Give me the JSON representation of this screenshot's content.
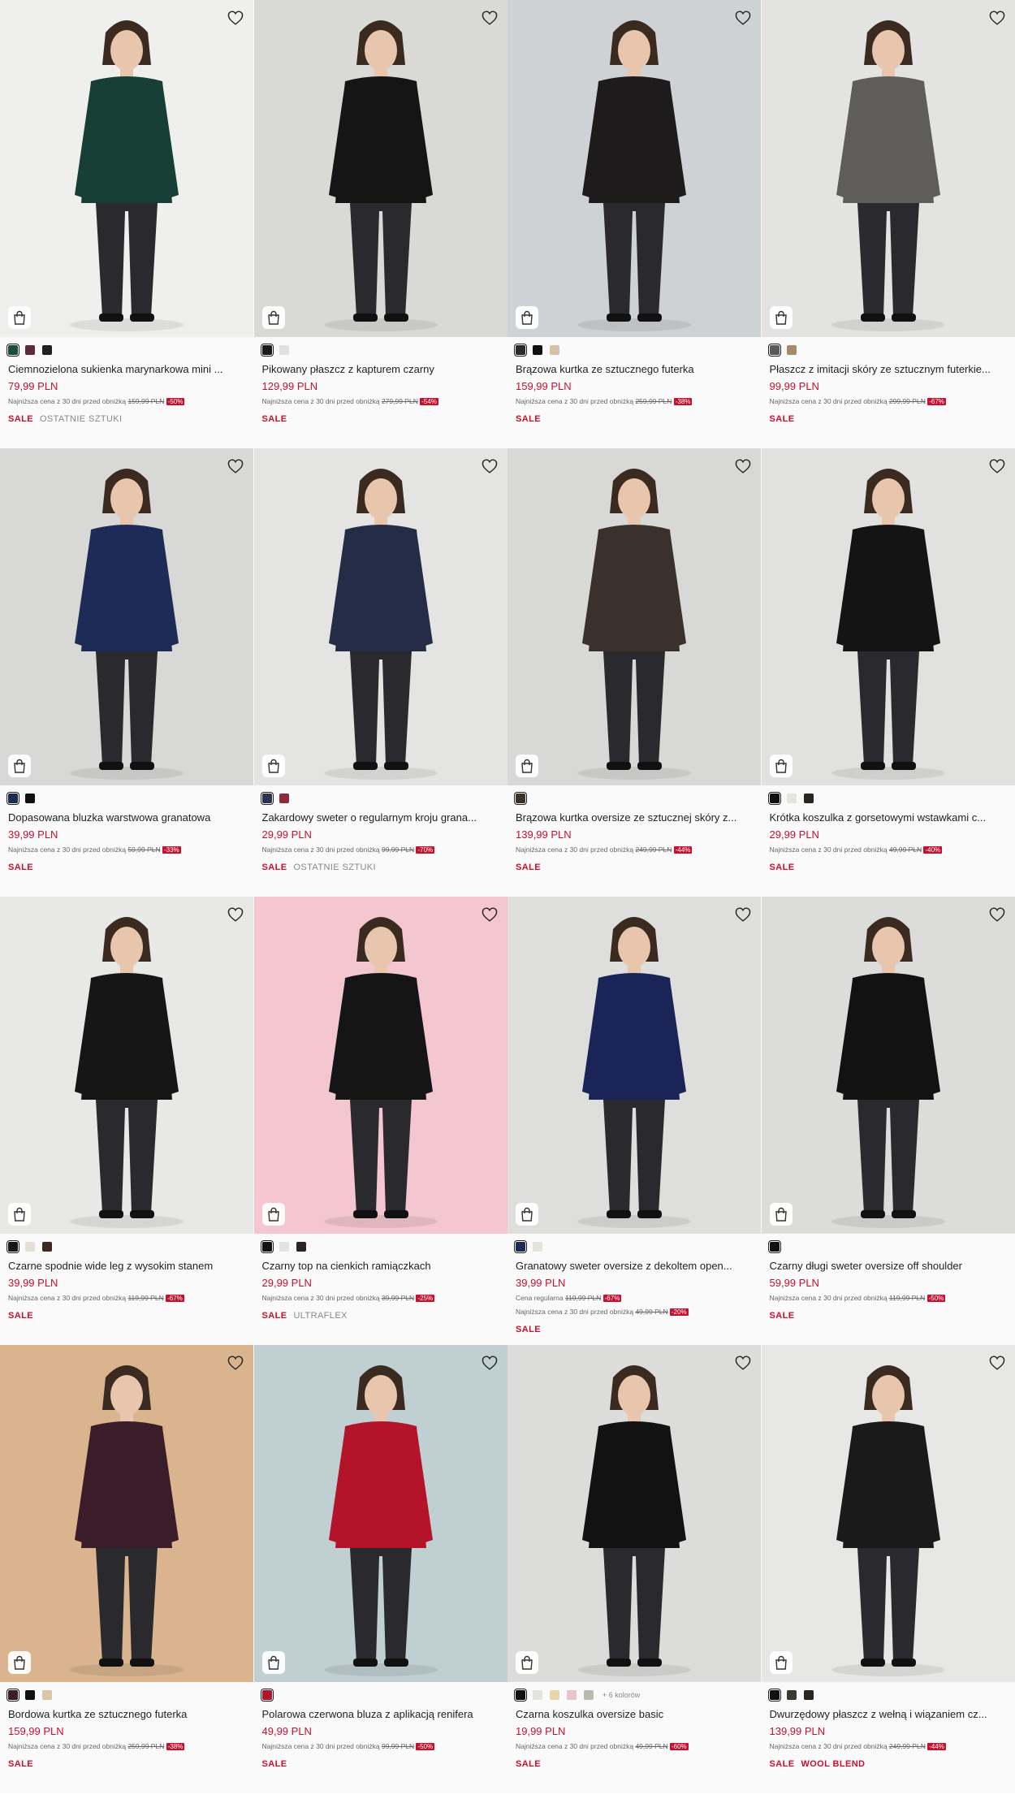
{
  "products": [
    {
      "name": "Ciemnozielona sukienka marynarkowa mini ...",
      "price": "79,99 PLN",
      "lowest_label": "Najniższa cena z 30 dni przed obniżką",
      "old_price": "159,99 PLN",
      "discount": "-50%",
      "tags": [
        "SALE",
        "OSTATNIE SZTUKI"
      ],
      "swatches": [
        "#1c4b3f",
        "#5a2b39",
        "#222222"
      ],
      "bg": "#efefed",
      "outfit": "#173f35"
    },
    {
      "name": "Pikowany płaszcz z kapturem czarny",
      "price": "129,99 PLN",
      "lowest_label": "Najniższa cena z 30 dni przed obniżką",
      "old_price": "279,99 PLN",
      "discount": "-54%",
      "tags": [
        "SALE"
      ],
      "swatches": [
        "#1a1a1a",
        "#e2e0da"
      ],
      "bg": "#d9d9d6",
      "outfit": "#151515"
    },
    {
      "name": "Brązowa kurtka ze sztucznego futerka",
      "price": "159,99 PLN",
      "lowest_label": "Najniższa cena z 30 dni przed obniżką",
      "old_price": "259,99 PLN",
      "discount": "-38%",
      "tags": [
        "SALE"
      ],
      "swatches": [
        "#2a2a2a",
        "#111111",
        "#d7c2a6"
      ],
      "bg": "#cfd2d4",
      "outfit": "#1d1b1b"
    },
    {
      "name": "Płaszcz z imitacji skóry ze sztucznym futerkie...",
      "price": "99,99 PLN",
      "lowest_label": "Najniższa cena z 30 dni przed obniżką",
      "old_price": "299,99 PLN",
      "discount": "-67%",
      "tags": [
        "SALE"
      ],
      "swatches": [
        "#5a5a58",
        "#a68a6a"
      ],
      "bg": "#e3e3e1",
      "outfit": "#5f5d5a"
    },
    {
      "name": "Dopasowana bluzka warstwowa granatowa",
      "price": "39,99 PLN",
      "lowest_label": "Najniższa cena z 30 dni przed obniżką",
      "old_price": "59,99 PLN",
      "discount": "-33%",
      "tags": [
        "SALE"
      ],
      "swatches": [
        "#1d2a52",
        "#111111"
      ],
      "bg": "#d8d8d6",
      "outfit": "#1f2b57"
    },
    {
      "name": "Zakardowy sweter o regularnym kroju grana...",
      "price": "29,99 PLN",
      "lowest_label": "Najniższa cena z 30 dni przed obniżką",
      "old_price": "99,99 PLN",
      "discount": "-70%",
      "tags": [
        "SALE",
        "OSTATNIE SZTUKI"
      ],
      "swatches": [
        "#2c3350",
        "#8e2c3a"
      ],
      "bg": "#e4e4e2",
      "outfit": "#242c48"
    },
    {
      "name": "Brązowa kurtka oversize ze sztucznej skóry z...",
      "price": "139,99 PLN",
      "lowest_label": "Najniższa cena z 30 dni przed obniżką",
      "old_price": "249,99 PLN",
      "discount": "-44%",
      "tags": [
        "SALE"
      ],
      "swatches": [
        "#3a302c"
      ],
      "bg": "#d8d8d6",
      "outfit": "#3a302c"
    },
    {
      "name": "Krótka koszulka z gorsetowymi wstawkami c...",
      "price": "29,99 PLN",
      "lowest_label": "Najniższa cena z 30 dni przed obniżką",
      "old_price": "49,99 PLN",
      "discount": "-40%",
      "tags": [
        "SALE"
      ],
      "swatches": [
        "#111111",
        "#e5e3de",
        "#2b2420"
      ],
      "bg": "#e1e1df",
      "outfit": "#141414"
    },
    {
      "name": "Czarne spodnie wide leg z wysokim stanem",
      "price": "39,99 PLN",
      "lowest_label": "Najniższa cena z 30 dni przed obniżką",
      "old_price": "119,99 PLN",
      "discount": "-67%",
      "tags": [
        "SALE"
      ],
      "swatches": [
        "#161616",
        "#e4e0d4",
        "#3a2a22"
      ],
      "bg": "#e8e8e6",
      "outfit": "#161616"
    },
    {
      "name": "Czarny top na cienkich ramiączkach",
      "price": "29,99 PLN",
      "lowest_label": "Najniższa cena z 30 dni przed obniżką",
      "old_price": "39,99 PLN",
      "discount": "-25%",
      "tags": [
        "SALE",
        "ULTRAFLEX"
      ],
      "swatches": [
        "#111111",
        "#e5e3de",
        "#2b2420"
      ],
      "bg": "#f4c6cf",
      "outfit": "#151515"
    },
    {
      "name": "Granatowy sweter oversize z dekoltem open...",
      "price": "39,99 PLN",
      "regular_label": "Cena regularna",
      "regular_price": "119,99 PLN",
      "regular_discount": "-67%",
      "lowest_label": "Najniższa cena z 30 dni przed obniżką",
      "old_price": "49,99 PLN",
      "discount": "-20%",
      "tags": [
        "SALE"
      ],
      "swatches": [
        "#1d2a52",
        "#e5e3de"
      ],
      "bg": "#dededc",
      "outfit": "#1b2456"
    },
    {
      "name": "Czarny długi sweter oversize off shoulder",
      "price": "59,99 PLN",
      "lowest_label": "Najniższa cena z 30 dni przed obniżką",
      "old_price": "119,99 PLN",
      "discount": "-50%",
      "tags": [
        "SALE"
      ],
      "swatches": [
        "#111111"
      ],
      "bg": "#dcdcda",
      "outfit": "#121212"
    },
    {
      "name": "Bordowa kurtka ze sztucznego futerka",
      "price": "159,99 PLN",
      "lowest_label": "Najniższa cena z 30 dni przed obniżką",
      "old_price": "259,99 PLN",
      "discount": "-38%",
      "tags": [
        "SALE"
      ],
      "swatches": [
        "#3b1d2a",
        "#111111",
        "#d9c7a8"
      ],
      "bg": "#d9b48e",
      "outfit": "#3b1d2a"
    },
    {
      "name": "Polarowa czerwona bluza z aplikacją renifera",
      "price": "49,99 PLN",
      "lowest_label": "Najniższa cena z 30 dni przed obniżką",
      "old_price": "99,99 PLN",
      "discount": "-50%",
      "tags": [
        "SALE"
      ],
      "swatches": [
        "#b4142a"
      ],
      "bg": "#bfcfd2",
      "outfit": "#b4142a"
    },
    {
      "name": "Czarna koszulka oversize basic",
      "price": "19,99 PLN",
      "lowest_label": "Najniższa cena z 30 dni przed obniżką",
      "old_price": "49,99 PLN",
      "discount": "-60%",
      "tags": [
        "SALE"
      ],
      "swatches": [
        "#111111",
        "#e5e3de",
        "#e6d6a8",
        "#e8c4c8",
        "#b8bcae"
      ],
      "more_colors": "+ 6 kolorów",
      "bg": "#dcdcda",
      "outfit": "#121212"
    },
    {
      "name": "Dwurzędowy płaszcz z wełną i wiązaniem cz...",
      "price": "139,99 PLN",
      "lowest_label": "Najniższa cena z 30 dni przed obniżką",
      "old_price": "249,99 PLN",
      "discount": "-44%",
      "tags": [
        "SALE",
        "WOOL BLEND"
      ],
      "swatches": [
        "#111111",
        "#3a3a2e",
        "#2b2420"
      ],
      "bg": "#e7e7e5",
      "outfit": "#1a1a1a"
    }
  ],
  "icons": {
    "wishlist": "heart-outline-icon",
    "cart": "shopping-bag-icon"
  }
}
